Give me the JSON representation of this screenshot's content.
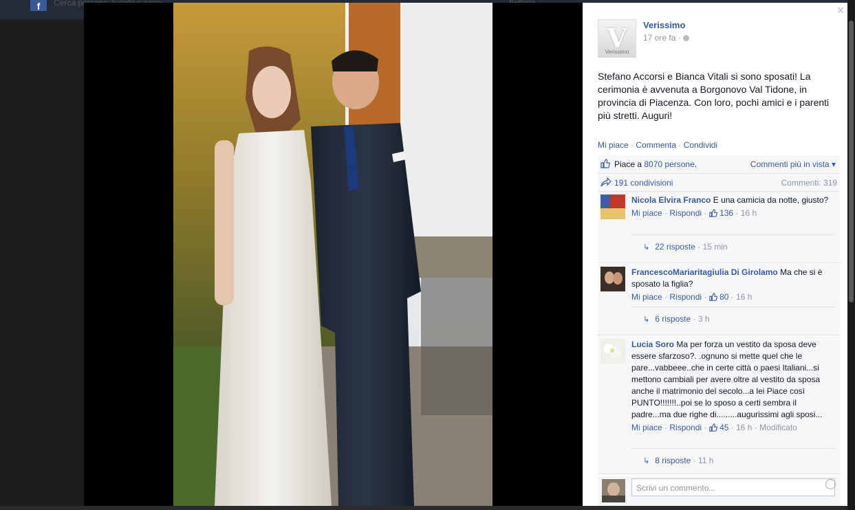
{
  "background": {
    "search_text": "Cerca persone, luoghi e cose",
    "right_links": "Bettona"
  },
  "post": {
    "page_name": "Verissimo",
    "logo_text": "Verissimo",
    "time": "17 ore fa ·",
    "text": "Stefano Accorsi e Bianca Vitali si sono sposati! La cerimonia è avvenuta a Borgonovo Val Tidone, in provincia di Piacenza. Con loro, pochi amici e i parenti più stretti. Auguri!",
    "actions": {
      "like": "Mi piace",
      "comment": "Commenta",
      "share": "Condividi",
      "sep": " · "
    },
    "likes_prefix": "Piace a ",
    "likes_link": "8070 persone",
    "likes_suffix": ".",
    "sort_label": "Commenti più in vista ▾",
    "shares": "191 condivisioni",
    "comments_count": "Commenti: 319"
  },
  "comments": [
    {
      "author": "Nicola Elvira Franco",
      "text": " E una camicia da notte, giusto?",
      "like": "Mi piace",
      "reply": "Rispondi",
      "likes": "136",
      "time": " · 16 h",
      "edited": "",
      "replies": "22 risposte",
      "replies_time": " · 15 min"
    },
    {
      "author": "FrancescoMariaritagiulia Di Girolamo",
      "text": " Ma che si è sposato la figlia?",
      "like": "Mi piace",
      "reply": "Rispondi",
      "likes": "80",
      "time": " · 16 h",
      "edited": "",
      "replies": "6 risposte",
      "replies_time": " · 3 h"
    },
    {
      "author": "Lucia Soro",
      "text": " Ma per forza un vestito da sposa deve essere sfarzoso?. .ognuno si mette quel che le pare...vabbeee..che in certe città o paesi Italiani...si mettono cambiali per avere oltre al vestito da sposa anche il matrimonio del secolo...a lei Piace così PUNTO!!!!!!!..poi se lo sposo a certi sembra il padre...ma due righe di.........augurissimi agli sposi...",
      "like": "Mi piace",
      "reply": "Rispondi",
      "likes": "45",
      "time": " · 16 h",
      "edited": " · Modificato",
      "replies": "8 risposte",
      "replies_time": " · 11 h"
    }
  ],
  "composer": {
    "placeholder": "Scrivi un commento..."
  },
  "icons": {
    "close": "close-icon",
    "globe": "globe-icon",
    "like": "thumbs-up-icon",
    "share": "share-arrow-icon",
    "reply": "reply-arrow-icon",
    "emoji": "emoji-icon"
  },
  "colors": {
    "link": "#3b5998",
    "muted": "#90949c",
    "panel_bg": "#f6f7f9"
  }
}
